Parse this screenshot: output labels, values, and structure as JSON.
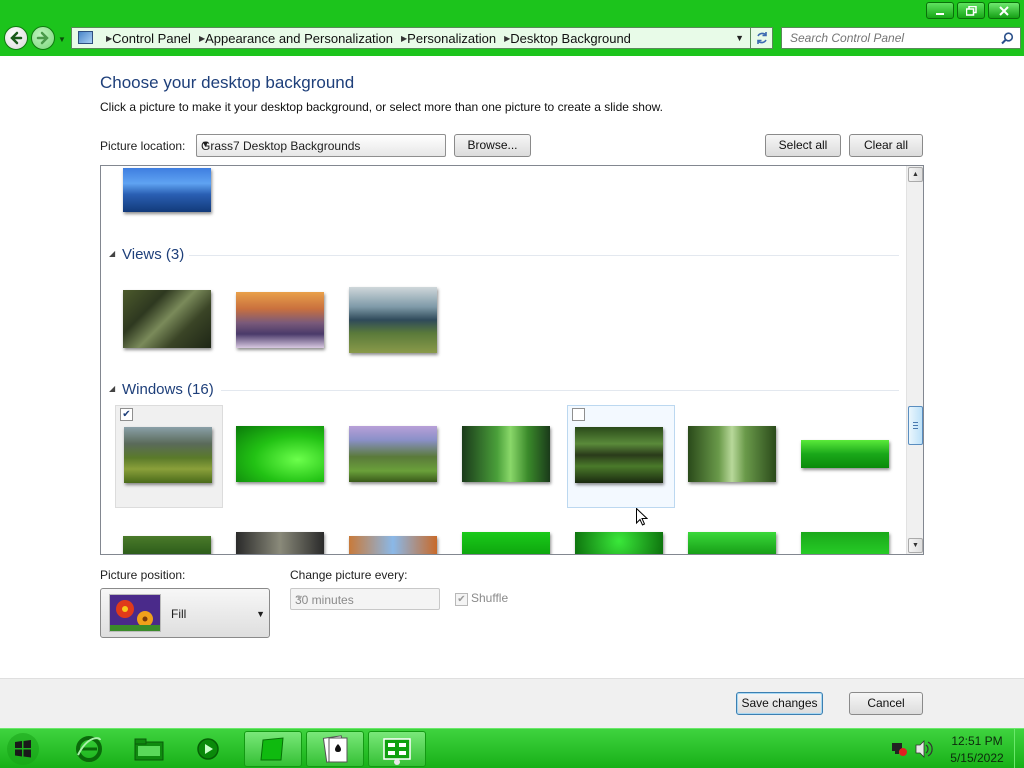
{
  "window": {
    "minimize_icon": "minimize-icon",
    "maximize_icon": "restore-icon",
    "close_icon": "close-icon"
  },
  "navigation": {
    "breadcrumb": [
      "Control Panel",
      "Appearance and Personalization",
      "Personalization",
      "Desktop Background"
    ],
    "search_placeholder": "Search Control Panel"
  },
  "page": {
    "title": "Choose your desktop background",
    "description": "Click a picture to make it your desktop background, or select more than one picture to create a slide show."
  },
  "picture_location": {
    "label": "Picture location:",
    "value": "Grass7 Desktop Backgrounds",
    "browse_label": "Browse...",
    "select_all_label": "Select all",
    "clear_all_label": "Clear all"
  },
  "groups": [
    {
      "name": "Views (3)"
    },
    {
      "name": "Windows (16)"
    }
  ],
  "tiles": {
    "windows_first_checked": true,
    "windows_hover_checked": false
  },
  "picture_position": {
    "label": "Picture position:",
    "value": "Fill"
  },
  "slideshow": {
    "label": "Change picture every:",
    "interval": "30 minutes",
    "shuffle_label": "Shuffle",
    "shuffle_checked": true
  },
  "footer": {
    "save_label": "Save changes",
    "cancel_label": "Cancel"
  },
  "taskbar": {
    "time": "12:51 PM",
    "date": "5/15/2022"
  },
  "colors": {
    "accent_green": "#1cc41c",
    "title_blue": "#1e3f7a"
  }
}
